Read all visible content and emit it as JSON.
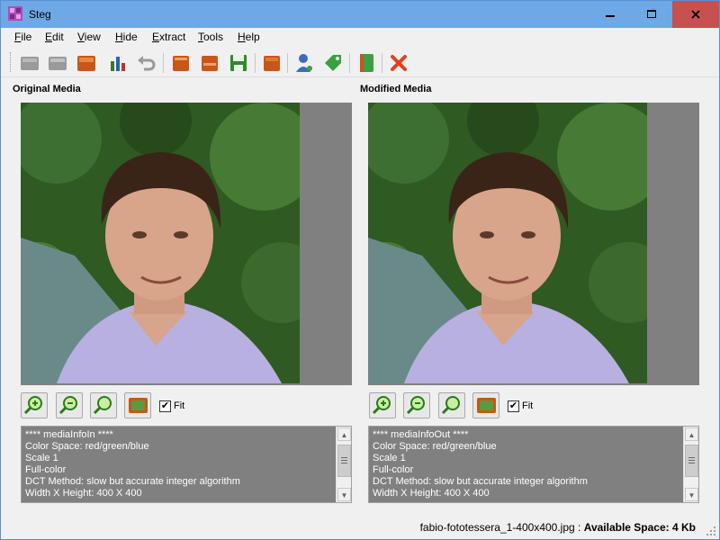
{
  "window": {
    "title": "Steg"
  },
  "menu": [
    {
      "key": "F",
      "rest": "ile"
    },
    {
      "key": "E",
      "rest": "dit"
    },
    {
      "key": "V",
      "rest": "iew"
    },
    {
      "key": "H",
      "rest": "ide"
    },
    {
      "key": "E",
      "rest": "xtract"
    },
    {
      "key": "T",
      "rest": "ools"
    },
    {
      "key": "H",
      "rest": "elp"
    }
  ],
  "toolbar": {
    "icons": [
      "new-icon",
      "open-icon",
      "save-icon",
      "chart-icon",
      "undo-icon",
      "book-open-icon",
      "book-save-icon",
      "floppy-icon",
      "book-icon",
      "user-key-icon",
      "tag-icon",
      "book-green-icon",
      "close-x-icon"
    ]
  },
  "left": {
    "title": "Original Media",
    "fit_label": "Fit",
    "fit_checked": true,
    "info_lines": [
      "**** mediaInfoIn ****",
      "Color Space: red/green/blue",
      "Scale 1",
      "Full-color",
      "DCT Method: slow but accurate integer algorithm",
      "Width X Height: 400 X 400"
    ]
  },
  "right": {
    "title": "Modified Media",
    "fit_label": "Fit",
    "fit_checked": true,
    "info_lines": [
      "**** mediaInfoOut ****",
      "Color Space: red/green/blue",
      "Scale 1",
      "Full-color",
      "DCT Method: slow but accurate integer algorithm",
      "Width X Height: 400 X 400"
    ]
  },
  "status": {
    "filename": "fabio-fototessera_1-400x400.jpg :",
    "space_label": "Available Space: 4 Kb"
  },
  "colors": {
    "titlebar": "#6ea8e5",
    "close": "#c75050",
    "info_bg": "#808080"
  }
}
